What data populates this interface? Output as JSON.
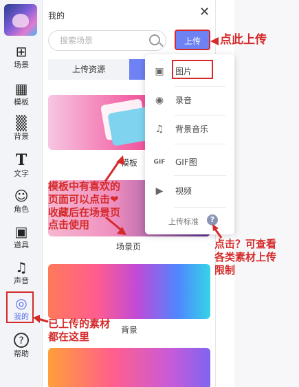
{
  "rail": {
    "items": [
      {
        "icon": "grid-icon",
        "glyph": "⊞",
        "label": "场景"
      },
      {
        "icon": "template-icon",
        "glyph": "▦",
        "label": "模板"
      },
      {
        "icon": "background-icon",
        "glyph": "▒",
        "label": "背景"
      },
      {
        "icon": "text-icon",
        "glyph": "T",
        "label": "文字"
      },
      {
        "icon": "character-icon",
        "glyph": "☺",
        "label": "角色"
      },
      {
        "icon": "props-icon",
        "glyph": "▣",
        "label": "道具"
      },
      {
        "icon": "sound-icon",
        "glyph": "♫",
        "label": "声音"
      },
      {
        "icon": "user-icon",
        "glyph": "◎",
        "label": "我的"
      },
      {
        "icon": "help-icon",
        "glyph": "?",
        "label": "帮助"
      }
    ]
  },
  "panel": {
    "title": "我的",
    "close": "✕",
    "search_placeholder": "搜索场景",
    "upload_label": "上传",
    "tabs": [
      "上传资源",
      ""
    ],
    "cards": [
      {
        "label": "模板"
      },
      {
        "label": "场景页"
      },
      {
        "label": "背景"
      }
    ]
  },
  "dropdown": {
    "items": [
      {
        "icon": "image-icon",
        "glyph": "▣",
        "label": "图片"
      },
      {
        "icon": "microphone-icon",
        "glyph": "◉",
        "label": "录音"
      },
      {
        "icon": "music-icon",
        "glyph": "♫",
        "label": "背景音乐"
      },
      {
        "icon": "gif-icon",
        "glyph": "GIF",
        "label": "GIF图"
      },
      {
        "icon": "video-icon",
        "glyph": "▶",
        "label": "视频"
      }
    ],
    "standard_label": "上传标准",
    "help_glyph": "?"
  },
  "annotations": {
    "upload_hint": "点此上传",
    "template_hint": [
      "模板中有喜欢的",
      "页面可以点击❤",
      "收藏后在场景页",
      "点击使用"
    ],
    "help_hint": [
      "点击？可查看",
      "各类素材上传",
      "限制"
    ],
    "my_hint": [
      "已上传的素材",
      "都在这里"
    ]
  },
  "colors": {
    "accent": "#6f82f3",
    "annotation": "#d42a2a"
  }
}
